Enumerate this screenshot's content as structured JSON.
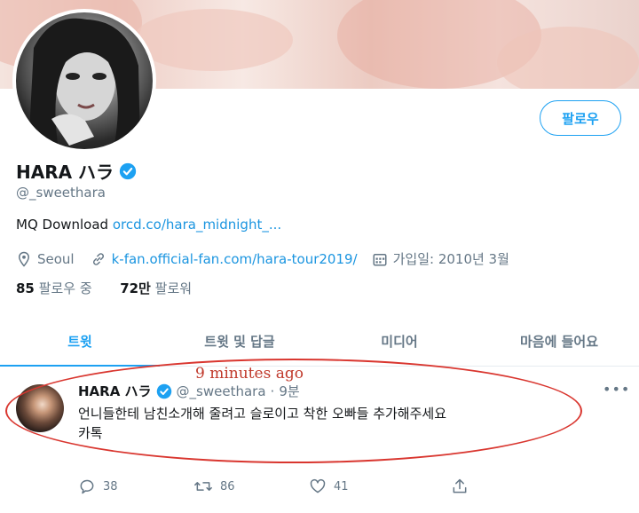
{
  "profile": {
    "follow_button": "팔로우",
    "name": "HARA ハラ",
    "handle": "@_sweethara",
    "bio_prefix": "MQ Download ",
    "bio_link": "orcd.co/hara_midnight_...",
    "location": "Seoul",
    "website": "k-fan.official-fan.com/hara-tour2019/",
    "joined": "가입일: 2010년 3월",
    "following_count": "85",
    "following_label": "팔로우 중",
    "followers_count": "72만",
    "followers_label": "팔로워"
  },
  "tabs": [
    "트윗",
    "트윗 및 답글",
    "미디어",
    "마음에 들어요"
  ],
  "tweet": {
    "name": "HARA ハラ",
    "handle": "@_sweethara",
    "sep": "·",
    "time": "9분",
    "more": "•••",
    "text_line1": "언니들한테 남친소개해 줄려고 슬로이고 착한 오빠들 추가해주세요",
    "text_line2": "카톡",
    "replies": "38",
    "retweets": "86",
    "likes": "41"
  },
  "annotation": {
    "text": "9 minutes ago",
    "color": "#d9362f"
  },
  "colors": {
    "accent": "#1da1f2",
    "secondary_text": "#657786"
  },
  "icons": [
    "verified-badge-icon",
    "location-icon",
    "link-icon",
    "calendar-icon",
    "reply-icon",
    "retweet-icon",
    "like-icon",
    "share-icon",
    "more-icon"
  ]
}
